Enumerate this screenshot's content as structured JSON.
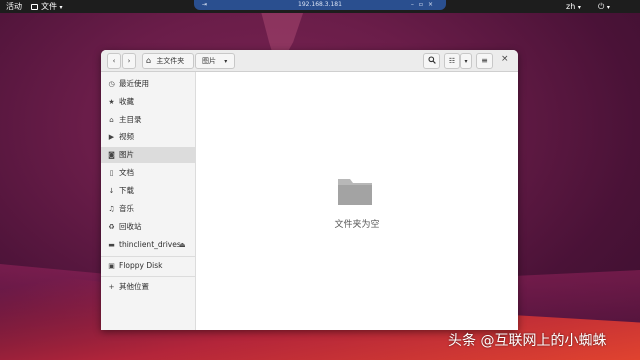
{
  "topbar": {
    "activities": "活动",
    "app_menu": "文件",
    "language": "zh",
    "connection_host": "192.168.3.181"
  },
  "window": {
    "pathbar": {
      "home_label": "主文件夹",
      "current_label": "图片"
    }
  },
  "sidebar": {
    "items": [
      {
        "label": "最近使用",
        "icon": "clock-icon"
      },
      {
        "label": "收藏",
        "icon": "star-icon"
      },
      {
        "label": "主目录",
        "icon": "home-icon"
      },
      {
        "label": "视频",
        "icon": "video-icon"
      },
      {
        "label": "图片",
        "icon": "camera-icon",
        "active": true
      },
      {
        "label": "文档",
        "icon": "document-icon"
      },
      {
        "label": "下载",
        "icon": "download-icon"
      },
      {
        "label": "音乐",
        "icon": "music-icon"
      },
      {
        "label": "回收站",
        "icon": "trash-icon"
      },
      {
        "label": "thinclient_drives",
        "icon": "drive-icon"
      },
      {
        "label": "Floppy Disk",
        "icon": "floppy-icon"
      },
      {
        "label": "其他位置",
        "icon": "plus-icon"
      }
    ]
  },
  "content": {
    "empty_message": "文件夹为空"
  },
  "watermark": "头条 @互联网上的小蜘蛛"
}
